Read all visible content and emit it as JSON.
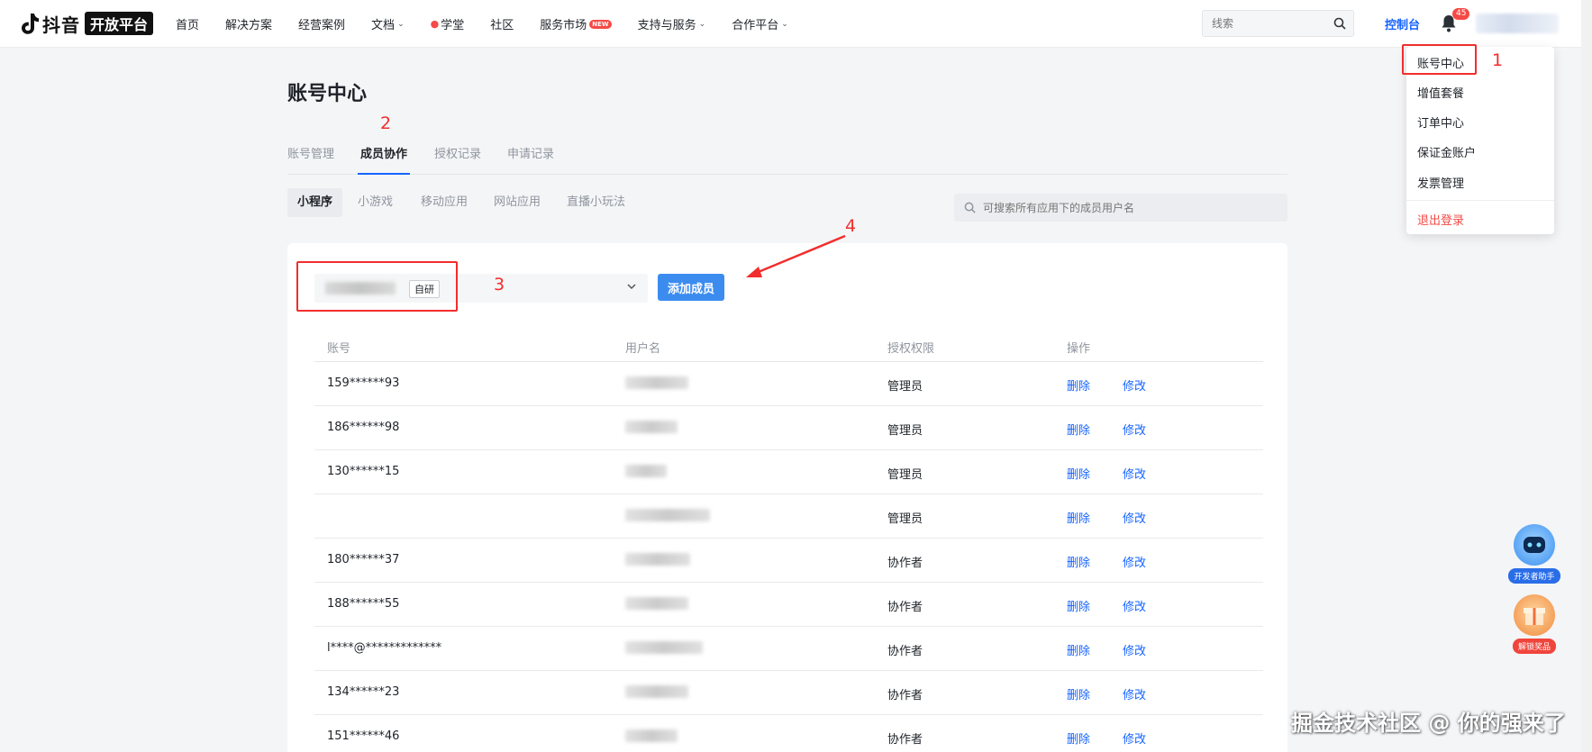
{
  "topnav": {
    "logo_text": "抖音",
    "logo_badge": "开放平台",
    "items": [
      {
        "label": "首页",
        "chevron": false
      },
      {
        "label": "解决方案",
        "chevron": false
      },
      {
        "label": "经营案例",
        "chevron": false
      },
      {
        "label": "文档",
        "chevron": true
      },
      {
        "label": "学堂",
        "chevron": false,
        "icon": "flame-drop-icon"
      },
      {
        "label": "社区",
        "chevron": false
      },
      {
        "label": "服务市场",
        "chevron": false,
        "badge": "NEW"
      },
      {
        "label": "支持与服务",
        "chevron": true
      },
      {
        "label": "合作平台",
        "chevron": true
      }
    ],
    "search_placeholder": "线索",
    "console_label": "控制台",
    "notification_count": "45"
  },
  "account_menu": {
    "items": [
      "账号中心",
      "增值套餐",
      "订单中心",
      "保证金账户",
      "发票管理"
    ],
    "logout": "退出登录"
  },
  "page": {
    "title": "账号中心",
    "tabs": [
      "账号管理",
      "成员协作",
      "授权记录",
      "申请记录"
    ],
    "active_tab": "成员协作",
    "subtabs": [
      "小程序",
      "小游戏",
      "移动应用",
      "网站应用",
      "直播小玩法"
    ],
    "active_subtab": "小程序",
    "member_search_placeholder": "可搜索所有应用下的成员用户名"
  },
  "card": {
    "app_tag": "自研",
    "add_button": "添加成员",
    "columns": [
      "账号",
      "用户名",
      "授权权限",
      "操作"
    ],
    "rows": [
      {
        "account": "159******93",
        "role": "管理员"
      },
      {
        "account": "186******98",
        "role": "管理员"
      },
      {
        "account": "130******15",
        "role": "管理员"
      },
      {
        "account": "",
        "role": "管理员"
      },
      {
        "account": "180******37",
        "role": "协作者"
      },
      {
        "account": "188******55",
        "role": "协作者"
      },
      {
        "account": "l****@*************",
        "role": "协作者"
      },
      {
        "account": "134******23",
        "role": "协作者"
      },
      {
        "account": "151******46",
        "role": "协作者"
      }
    ],
    "action_delete": "删除",
    "action_edit": "修改"
  },
  "annotations": [
    "1",
    "2",
    "3",
    "4"
  ],
  "floating": {
    "assistant_label": "开发者助手",
    "reward_label": "解锁奖品"
  },
  "watermark": "掘金技术社区 @ 你的强来了",
  "colors": {
    "accent": "#1664ff",
    "button": "#3c8cf0",
    "annotation": "#f22d2d",
    "danger": "#f54a45"
  }
}
